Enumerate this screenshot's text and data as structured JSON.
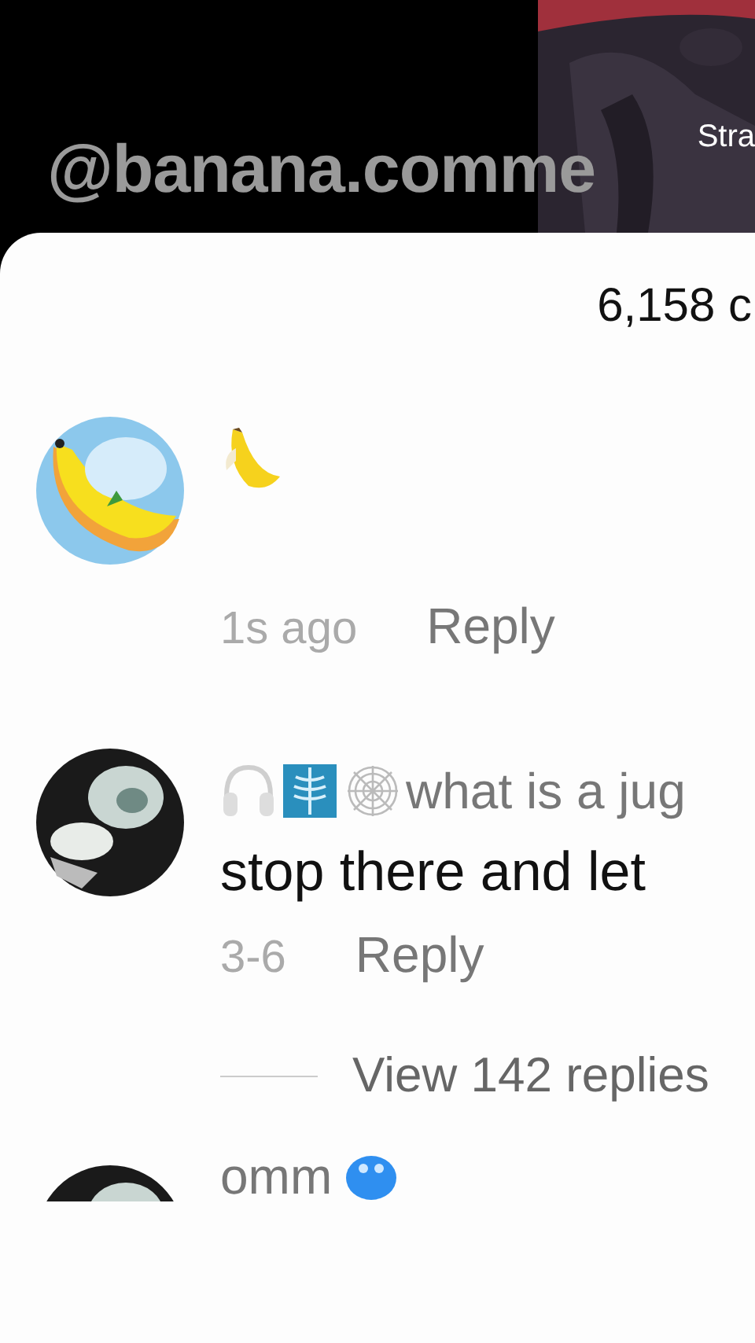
{
  "video": {
    "caption": "@banana.comme",
    "inset_label": "Stra"
  },
  "comments_sheet": {
    "count": "6,158 c",
    "comments": [
      {
        "kind": "emoji",
        "time": "1s ago",
        "reply": "Reply"
      },
      {
        "kind": "text",
        "username": "what is a jug",
        "text": "stop there and let",
        "time": "3-6",
        "reply": "Reply",
        "view_replies": "View 142 replies"
      },
      {
        "kind": "partial",
        "username": "omm"
      }
    ]
  }
}
